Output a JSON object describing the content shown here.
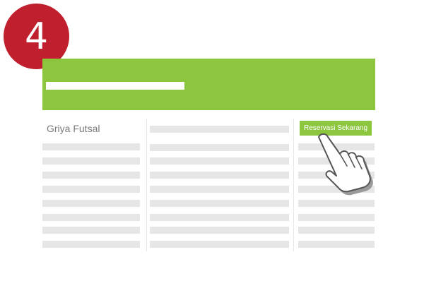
{
  "step": {
    "number": "4",
    "color": "#c0202e"
  },
  "header": {
    "color": "#8cc63f"
  },
  "venue": {
    "name": "Griya Futsal"
  },
  "action": {
    "reserve_label": "Reservasi Sekarang",
    "color": "#8cc63f"
  },
  "cursor": {
    "icon": "hand-pointer-icon"
  }
}
